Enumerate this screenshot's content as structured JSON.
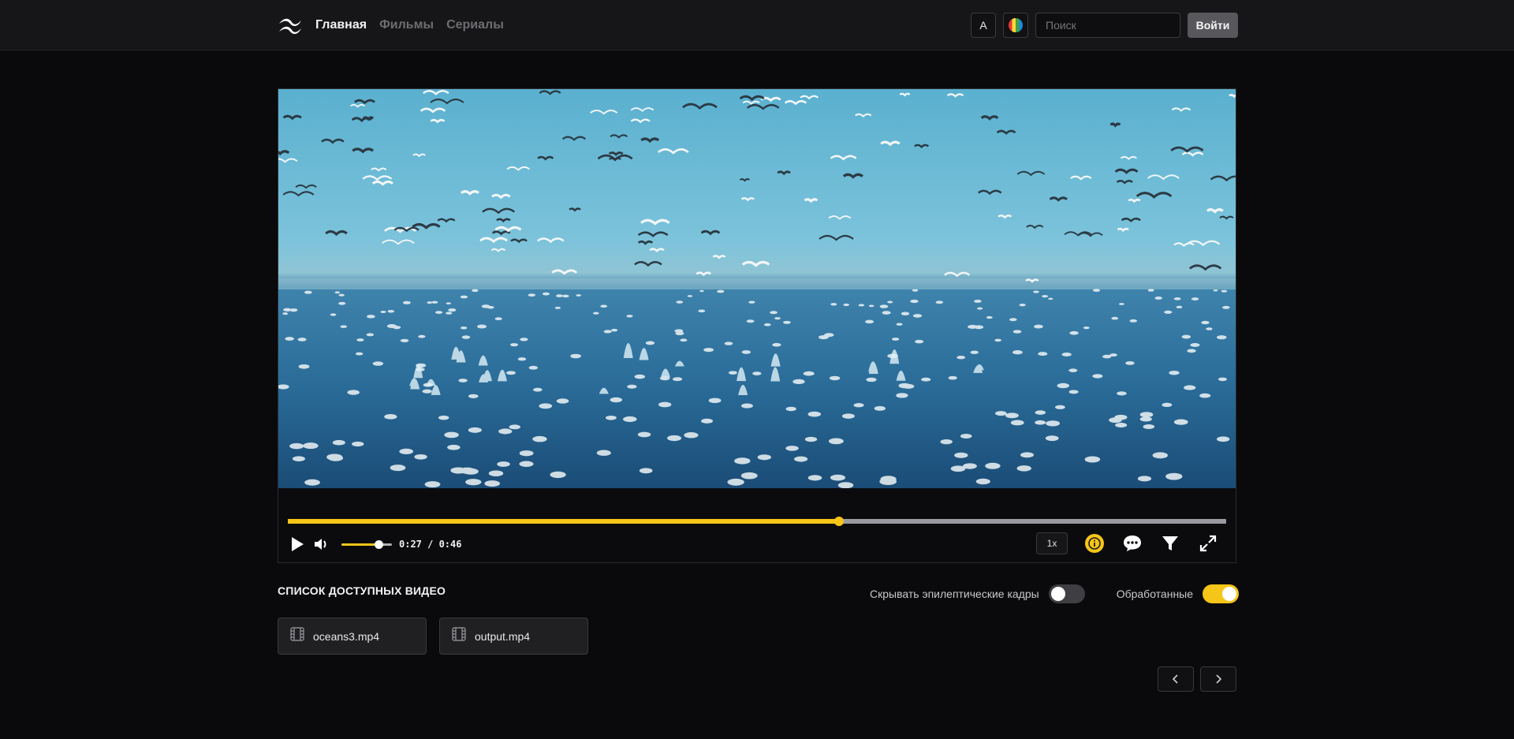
{
  "header": {
    "nav": [
      {
        "label": "Главная",
        "active": true
      },
      {
        "label": "Фильмы",
        "active": false
      },
      {
        "label": "Сериалы",
        "active": false
      }
    ],
    "font_button_label": "A",
    "search": {
      "placeholder": "Поиск",
      "value": ""
    },
    "login_label": "Войти"
  },
  "player": {
    "time_display": "0:27 / 0:46",
    "progress_fraction": 0.587,
    "volume_fraction": 0.74,
    "speed_label": "1x",
    "accent_color": "#f5c518",
    "icons": [
      "play-icon",
      "volume-icon",
      "info-icon",
      "subtitles-icon",
      "filter-icon",
      "fullscreen-icon"
    ]
  },
  "video_list": {
    "title": "СПИСОК ДОСТУПНЫХ ВИДЕО",
    "toggles": [
      {
        "label": "Скрывать эпилептические кадры",
        "on": false
      },
      {
        "label": "Обработанные",
        "on": true
      }
    ],
    "files": [
      {
        "name": "oceans3.mp4"
      },
      {
        "name": "output.mp4"
      }
    ]
  }
}
